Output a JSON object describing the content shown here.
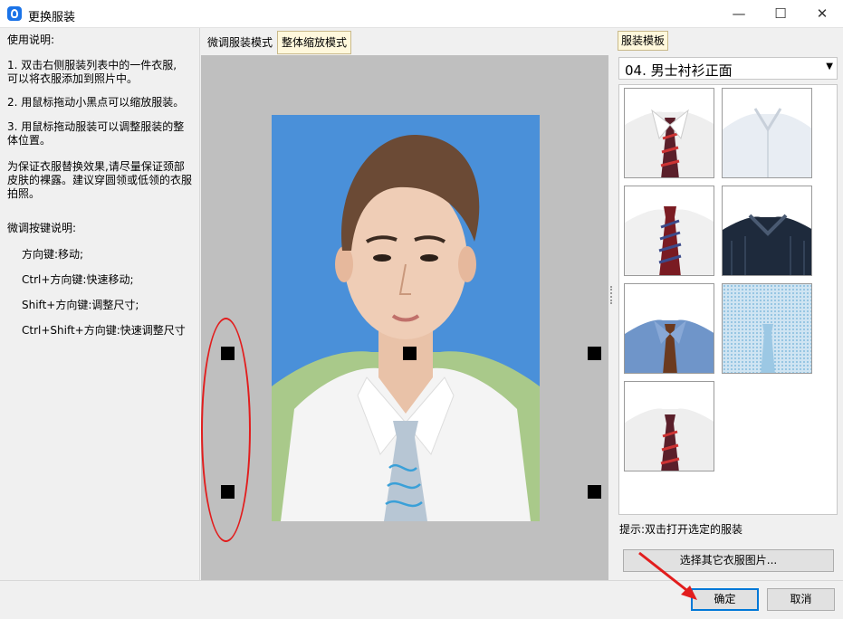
{
  "window": {
    "title": "更换服装",
    "minimize_glyph": "—",
    "maximize_glyph": "☐",
    "close_glyph": "✕"
  },
  "instructions": {
    "heading": "使用说明:",
    "step1": "1. 双击右侧服装列表中的一件衣服,\n可以将衣服添加到照片中。",
    "step2": "2. 用鼠标拖动小黑点可以缩放服装。",
    "step3": "3. 用鼠标拖动服装可以调整服装的整\n体位置。",
    "note": "为保证衣服替换效果,请尽量保证颈部\n皮肤的裸露。建议穿圆领或低领的衣服\n拍照。",
    "keys_heading": "微调按键说明:",
    "key1": "方向键:移动;",
    "key2": "Ctrl+方向键:快速移动;",
    "key3": "Shift+方向键:调整尺寸;",
    "key4": "Ctrl+Shift+方向键:快速调整尺寸"
  },
  "mode_tabs": {
    "fine_tune": "微调服装模式",
    "scale": "整体缩放模式"
  },
  "templates": {
    "tab_label": "服装模板",
    "selected_category": "04. 男士衬衫正面",
    "hint": "提示:双击打开选定的服装",
    "choose_button": "选择其它衣服图片..."
  },
  "buttons": {
    "ok": "确定",
    "cancel": "取消"
  },
  "colors": {
    "photo_background": "#4a90d9",
    "annotation_red": "#e21d1d",
    "accent": "#0078d7"
  }
}
